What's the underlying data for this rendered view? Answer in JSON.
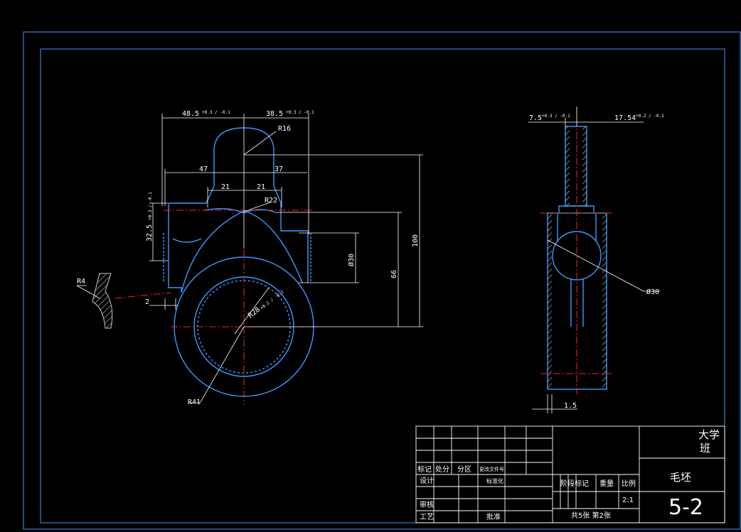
{
  "drawing": {
    "front_view": {
      "dims": {
        "top_left": "48.5",
        "top_left_tol": "+0.3 / -0.1",
        "top_right": "38.5",
        "top_right_tol": "+0.3 / -0.1",
        "radius_top": "R16",
        "width_left": "47",
        "width_right": "37",
        "inner_left": "21",
        "inner_right": "21",
        "radius_mid": "R22",
        "boss_height": "32.5",
        "boss_height_tol": "+0.3 / -0.1",
        "diameter_boss": "Ø30",
        "height_66": "66",
        "height_100": "100",
        "radius_r4": "R4",
        "thickness_2": "2",
        "bore": "R28",
        "bore_tol": "+0.2 / -0.1",
        "radius_bottom": "R41"
      }
    },
    "side_view": {
      "dims": {
        "left_top": "7.5",
        "left_top_tol": "+0.3 / -0.1",
        "right_top": "17.54",
        "right_top_tol": "+0.2 / -0.1",
        "diameter": "Ø30",
        "bottom": "1.5"
      }
    }
  },
  "title_block": {
    "row_labels": {
      "mark": "标记",
      "count": "处分",
      "zone": "分区",
      "doc_no": "更改文件号",
      "design": "设计",
      "standard": "标准化",
      "review": "审核",
      "process": "工艺",
      "approve": "批准"
    },
    "stage_mark": "阶段标记",
    "weight": "重量",
    "scale_label": "比例",
    "scale_value": "2:1",
    "sheets": "共5张  第2张",
    "school_line1": "大学",
    "school_line2": "班",
    "part_name": "毛坯",
    "drawing_no": "5-2"
  },
  "colors": {
    "frame": "#3a7fd0",
    "outline": "#3a9bff",
    "dimension": "#ffffff",
    "center": "#ff2020"
  }
}
